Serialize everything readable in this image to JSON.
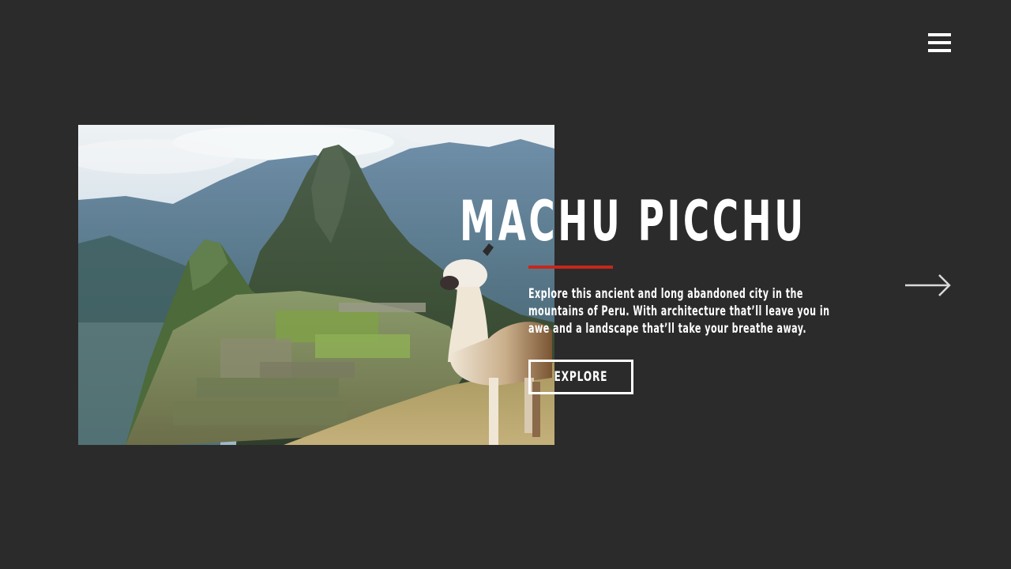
{
  "header": {
    "menu_icon": "hamburger-menu-icon"
  },
  "hero": {
    "image_subject": "machu-picchu-llama-photo",
    "title": "MACHU PICCHU",
    "description": "Explore this ancient and long abandoned  city in the mountains of Peru. With architecture that’ll leave you in awe and a landscape that’ll take your breathe away.",
    "cta_label": "EXPLORE",
    "next_icon": "arrow-right-icon"
  },
  "colors": {
    "background": "#2b2b2b",
    "text": "#ffffff",
    "accent": "#c8261b"
  }
}
